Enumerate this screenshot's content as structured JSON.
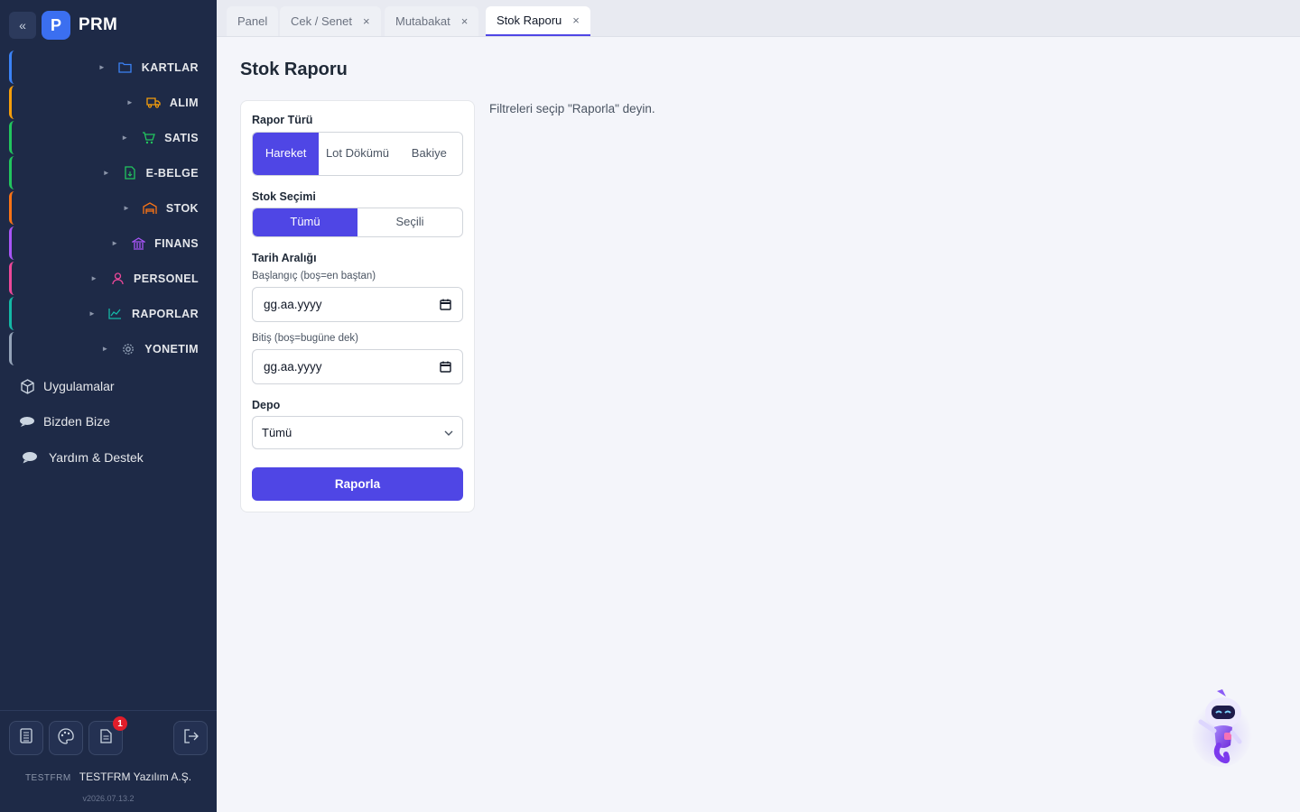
{
  "brand": {
    "collapse": "«",
    "logo_letter": "P",
    "name": "PRM"
  },
  "nav": [
    {
      "label": "KARTLAR",
      "icon": "folder-icon",
      "color": "#3b82f6"
    },
    {
      "label": "ALIM",
      "icon": "truck-icon",
      "color": "#f59e0b"
    },
    {
      "label": "SATIS",
      "icon": "cart-icon",
      "color": "#22c55e"
    },
    {
      "label": "E-BELGE",
      "icon": "document-icon",
      "color": "#22c55e"
    },
    {
      "label": "STOK",
      "icon": "warehouse-icon",
      "color": "#f97316"
    },
    {
      "label": "FINANS",
      "icon": "bank-icon",
      "color": "#a855f7"
    },
    {
      "label": "PERSONEL",
      "icon": "person-icon",
      "color": "#ec4899"
    },
    {
      "label": "RAPORLAR",
      "icon": "chart-icon",
      "color": "#14b8a6"
    },
    {
      "label": "YONETIM",
      "icon": "gear-icon",
      "color": "#94a3b8"
    }
  ],
  "extras": [
    {
      "label": "Uygulamalar",
      "icon": "cube-icon"
    },
    {
      "label": "Bizden Bize",
      "icon": "chat-icon"
    },
    {
      "label": "Yardım & Destek",
      "icon": "speech-bubble-icon"
    }
  ],
  "footer": {
    "badge_count": "1",
    "company_code": "TESTFRM",
    "company_name": "TESTFRM Yazılım A.Ş.",
    "version": "v2026.07.13.2"
  },
  "tabs": [
    {
      "label": "Panel",
      "closable": false
    },
    {
      "label": "Cek / Senet",
      "closable": true
    },
    {
      "label": "Mutabakat",
      "closable": true
    },
    {
      "label": "Stok Raporu",
      "closable": true,
      "active": true
    }
  ],
  "tab_close": "×",
  "page_title": "Stok Raporu",
  "hint": "Filtreleri seçip \"Raporla\" deyin.",
  "form": {
    "report_type_label": "Rapor Türü",
    "report_type_options": [
      "Hareket",
      "Lot Dökümü",
      "Bakiye"
    ],
    "report_type_selected": "Hareket",
    "stock_selection_label": "Stok Seçimi",
    "stock_selection_options": [
      "Tümü",
      "Seçili"
    ],
    "stock_selection_selected": "Tümü",
    "date_range_label": "Tarih Aralığı",
    "start_label": "Başlangıç (boş=en baştan)",
    "start_placeholder": "gg.aa.yyyy",
    "end_label": "Bitiş (boş=bugüne dek)",
    "end_placeholder": "gg.aa.yyyy",
    "warehouse_label": "Depo",
    "warehouse_value": "Tümü",
    "submit_label": "Raporla"
  },
  "colors": {
    "accent": "#4f46e5",
    "sidebar_bg": "#1e2a47",
    "logo": "#3b6ff0",
    "badge": "#e11d2a"
  }
}
